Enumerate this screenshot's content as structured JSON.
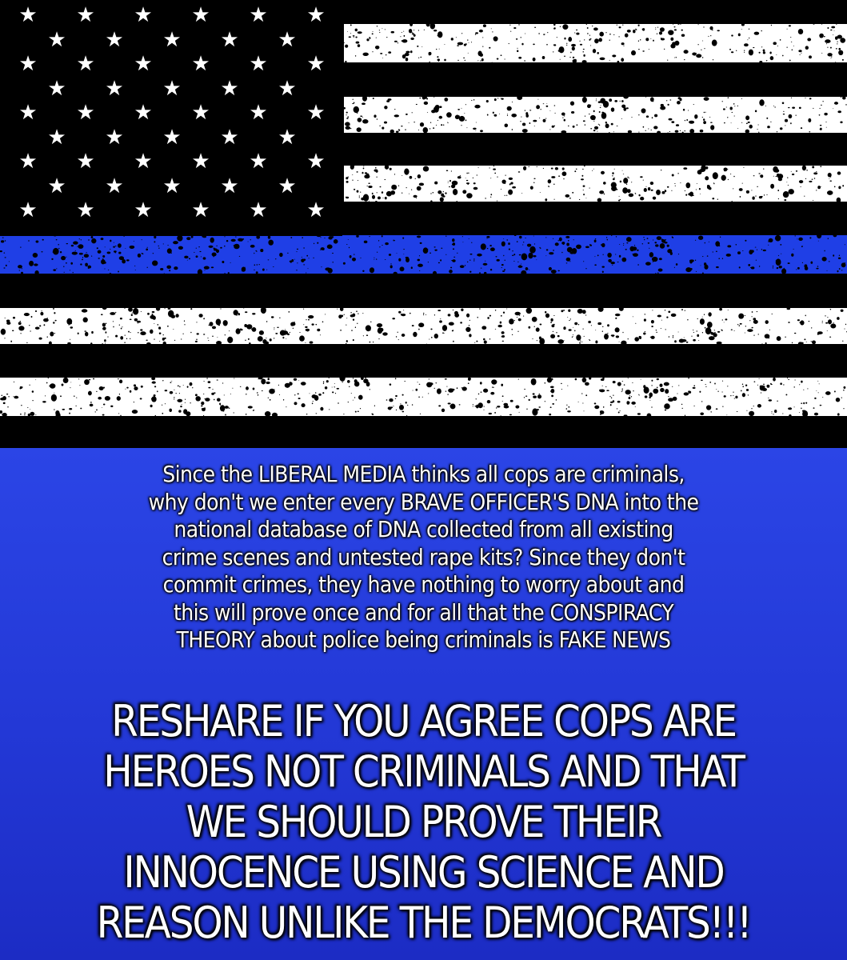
{
  "flag": {
    "stripe_color": "#ffffff",
    "field_color": "#000000",
    "thin_line_color": "#1f3fe6",
    "star_icon": "star-icon",
    "star_glyph": "★"
  },
  "message": {
    "body_lines": [
      "Since the LIBERAL MEDIA thinks all cops are criminals,",
      "why don't we enter every BRAVE OFFICER'S DNA into the",
      "national database of DNA collected from all existing",
      "crime scenes and untested rape kits? Since they don't",
      "commit crimes, they have nothing to worry about and",
      "this will prove once and for all that the CONSPIRACY",
      "THEORY about police being criminals is FAKE NEWS"
    ],
    "cta_lines": [
      "RESHARE IF YOU AGREE COPS ARE",
      "HEROES NOT CRIMINALS AND THAT",
      "WE SHOULD PROVE THEIR",
      "INNOCENCE USING SCIENCE AND",
      "REASON UNLIKE THE DEMOCRATS!!!"
    ],
    "panel_color": "#2338d6"
  }
}
